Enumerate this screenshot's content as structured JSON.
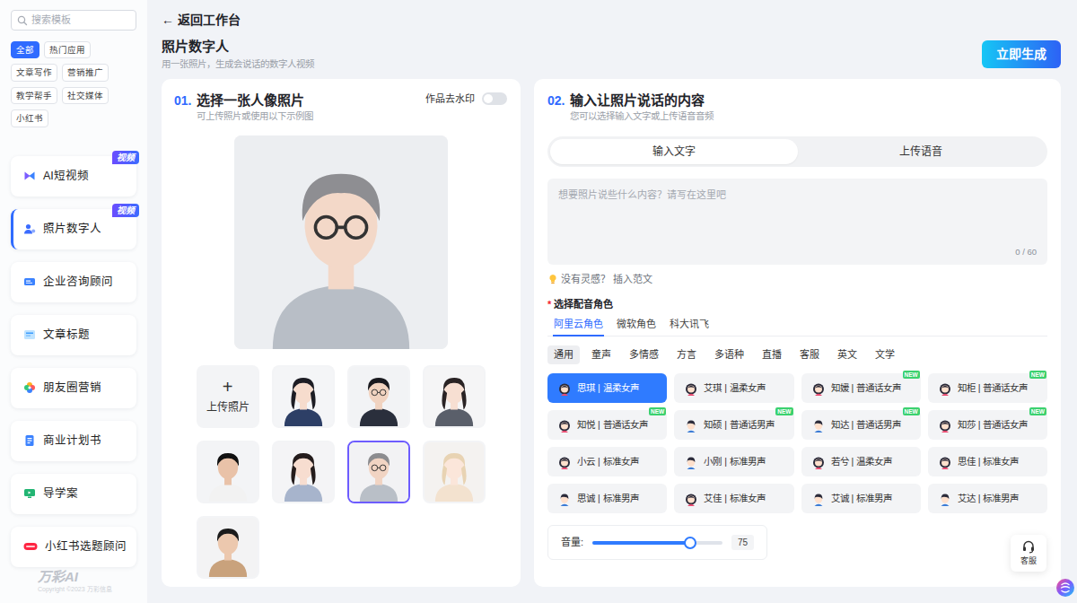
{
  "sidebar": {
    "search": {
      "placeholder": "搜索模板"
    },
    "tags": [
      {
        "label": "全部",
        "selected": true
      },
      {
        "label": "热门应用",
        "selected": false
      },
      {
        "label": "文章写作",
        "selected": false
      },
      {
        "label": "营销推广",
        "selected": false
      },
      {
        "label": "教学帮手",
        "selected": false
      },
      {
        "label": "社交媒体",
        "selected": false
      },
      {
        "label": "小红书",
        "selected": false
      }
    ],
    "items": [
      {
        "label": "AI短视频",
        "badge": "视频",
        "selected": false
      },
      {
        "label": "照片数字人",
        "badge": "视频",
        "selected": true
      },
      {
        "label": "企业咨询顾问",
        "badge": null,
        "selected": false
      },
      {
        "label": "文章标题",
        "badge": null,
        "selected": false
      },
      {
        "label": "朋友圈营销",
        "badge": null,
        "selected": false
      },
      {
        "label": "商业计划书",
        "badge": null,
        "selected": false
      },
      {
        "label": "导学案",
        "badge": null,
        "selected": false
      },
      {
        "label": "小红书选题顾问",
        "badge": null,
        "selected": false
      }
    ],
    "logo": "万彩AI",
    "copyright": "Copyright ©2023 万彩信息"
  },
  "header": {
    "back_icon": "←",
    "back": "返回工作台",
    "title": "照片数字人",
    "subtitle": "用一张照片，生成会说话的数字人视频",
    "generate": "立即生成"
  },
  "photo_step": {
    "number": "01.",
    "title": "选择一张人像照片",
    "subtitle": "可上传照片或使用以下示例图",
    "watermark": {
      "label": "作品去水印",
      "on": false
    },
    "upload": {
      "icon": "+",
      "label": "上传照片"
    },
    "photos": [
      {
        "selected": false
      },
      {
        "selected": false
      },
      {
        "selected": false
      },
      {
        "selected": false
      },
      {
        "selected": false
      },
      {
        "selected": true
      },
      {
        "selected": false
      },
      {
        "selected": false
      }
    ]
  },
  "content_step": {
    "number": "02.",
    "title": "输入让照片说话的内容",
    "subtitle": "您可以选择输入文字或上传语音音频",
    "tabs": [
      {
        "label": "输入文字",
        "selected": true
      },
      {
        "label": "上传语音",
        "selected": false
      }
    ],
    "text": {
      "placeholder": "想要照片说些什么内容？请写在这里吧",
      "counter": "0 / 60"
    },
    "inspiration": {
      "prompt": "没有灵感？",
      "link": "插入范文"
    },
    "voice_label": {
      "required": "*",
      "label": "选择配音角色"
    },
    "providers": [
      {
        "label": "阿里云角色",
        "selected": true
      },
      {
        "label": "微软角色",
        "selected": false
      },
      {
        "label": "科大讯飞",
        "selected": false
      }
    ],
    "categories": [
      {
        "label": "通用",
        "selected": true
      },
      {
        "label": "童声",
        "selected": false
      },
      {
        "label": "多情感",
        "selected": false
      },
      {
        "label": "方言",
        "selected": false
      },
      {
        "label": "多语种",
        "selected": false
      },
      {
        "label": "直播",
        "selected": false
      },
      {
        "label": "客服",
        "selected": false
      },
      {
        "label": "英文",
        "selected": false
      },
      {
        "label": "文学",
        "selected": false
      }
    ],
    "voices": [
      {
        "label": "思琪 | 温柔女声",
        "kind": "female",
        "badge": null,
        "selected": true
      },
      {
        "label": "艾琪 | 温柔女声",
        "kind": "female",
        "badge": null,
        "selected": false
      },
      {
        "label": "知媛 | 普通话女声",
        "kind": "female",
        "badge": "NEW",
        "selected": false
      },
      {
        "label": "知柜 | 普通话女声",
        "kind": "female",
        "badge": "NEW",
        "selected": false
      },
      {
        "label": "知悦 | 普通话女声",
        "kind": "female",
        "badge": "NEW",
        "selected": false
      },
      {
        "label": "知硕 | 普通话男声",
        "kind": "male",
        "badge": "NEW",
        "selected": false
      },
      {
        "label": "知达 | 普通话男声",
        "kind": "male",
        "badge": "NEW",
        "selected": false
      },
      {
        "label": "知莎 | 普通话女声",
        "kind": "female",
        "badge": "NEW",
        "selected": false
      },
      {
        "label": "小云 | 标准女声",
        "kind": "female",
        "badge": null,
        "selected": false
      },
      {
        "label": "小刚 | 标准男声",
        "kind": "male",
        "badge": null,
        "selected": false
      },
      {
        "label": "若兮 | 温柔女声",
        "kind": "female",
        "badge": null,
        "selected": false
      },
      {
        "label": "思佳 | 标准女声",
        "kind": "female",
        "badge": null,
        "selected": false
      },
      {
        "label": "思诚 | 标准男声",
        "kind": "male",
        "badge": null,
        "selected": false
      },
      {
        "label": "艾佳 | 标准女声",
        "kind": "female",
        "badge": null,
        "selected": false
      },
      {
        "label": "艾诚 | 标准男声",
        "kind": "male",
        "badge": null,
        "selected": false
      },
      {
        "label": "艾达 | 标准男声",
        "kind": "male",
        "badge": null,
        "selected": false
      }
    ],
    "volume": {
      "label": "音量:",
      "level": 0.75,
      "reading": "75"
    }
  },
  "support": {
    "label": "客服"
  }
}
